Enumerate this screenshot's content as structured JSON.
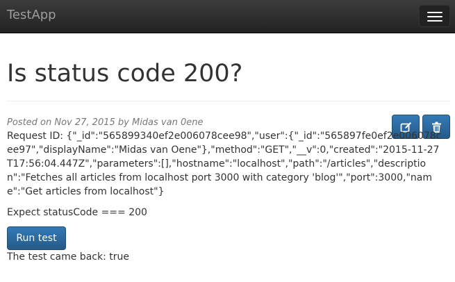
{
  "navbar": {
    "brand": "TestApp",
    "toggle_icon": "hamburger-icon",
    "background": "#222222"
  },
  "page": {
    "title": "Is status code 200?"
  },
  "article": {
    "meta": "Posted on Nov 27, 2015 by Midas van 0ene",
    "request_text": "Request ID: {\"_id\":\"565899340ef2e006078cee98\",\"user\":{\"_id\":\"565897fe0ef2e006078cee97\",\"displayName\":\"Midas van Oene\"},\"method\":\"GET\",\"__v\":0,\"created\":\"2015-11-27T17:56:04.447Z\",\"parameters\":[],\"hostname\":\"localhost\",\"path\":\"/articles\",\"description\":\"Fetches all articles from localhost port 3000 with category 'blog'\",\"port\":3000,\"name\":\"Get articles from localhost\"}",
    "edit_icon": "edit-icon",
    "delete_icon": "trash-icon"
  },
  "test": {
    "expectation": "Expect statusCode === 200",
    "run_label": "Run test",
    "result": "The test came back: true"
  },
  "colors": {
    "primary": "#337ab7",
    "primary_border": "#204d74",
    "text": "#333333",
    "muted": "#777777"
  }
}
